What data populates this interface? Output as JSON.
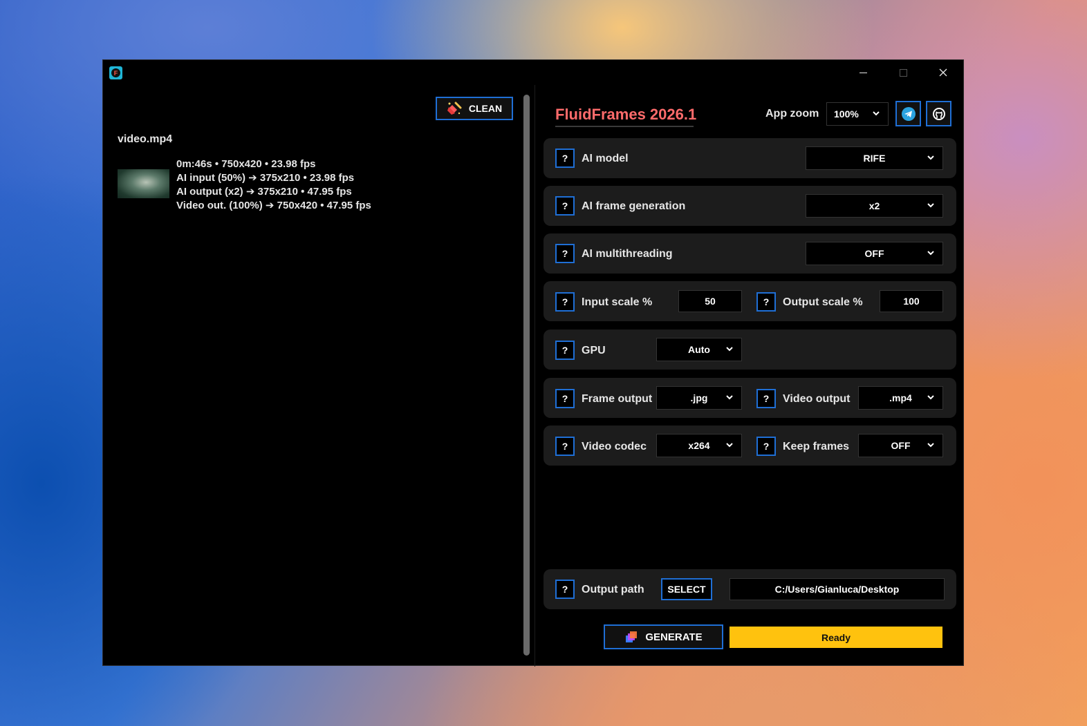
{
  "window": {
    "title": "",
    "icon": "fluidframes-app-icon"
  },
  "left_panel": {
    "clean_label": "CLEAN",
    "file": {
      "name": "video.mp4",
      "meta": [
        "0m:46s • 750x420 • 23.98 fps",
        "AI input (50%) ➔ 375x210 • 23.98 fps",
        "AI output (x2) ➔ 375x210 • 47.95 fps",
        "Video out. (100%) ➔ 750x420 • 47.95 fps"
      ]
    }
  },
  "header": {
    "title": "FluidFrames 2026.1",
    "zoom_label": "App zoom",
    "zoom_value": "100%"
  },
  "settings": {
    "help_label": "?",
    "ai_model": {
      "label": "AI model",
      "value": "RIFE"
    },
    "ai_frame_generation": {
      "label": "AI frame generation",
      "value": "x2"
    },
    "ai_multithreading": {
      "label": "AI multithreading",
      "value": "OFF"
    },
    "input_scale": {
      "label": "Input scale %",
      "value": "50"
    },
    "output_scale": {
      "label": "Output scale %",
      "value": "100"
    },
    "gpu": {
      "label": "GPU",
      "value": "Auto"
    },
    "frame_output": {
      "label": "Frame output",
      "value": ".jpg"
    },
    "video_output": {
      "label": "Video output",
      "value": ".mp4"
    },
    "video_codec": {
      "label": "Video codec",
      "value": "x264"
    },
    "keep_frames": {
      "label": "Keep frames",
      "value": "OFF"
    },
    "output_path": {
      "label": "Output path",
      "select_label": "SELECT",
      "value": "C:/Users/Gianluca/Desktop"
    }
  },
  "footer": {
    "generate_label": "GENERATE",
    "status": "Ready"
  },
  "colors": {
    "accent": "#1f6fd6",
    "title": "#ff6b6b",
    "status": "#ffc20e",
    "row_bg": "#1c1c1c"
  }
}
